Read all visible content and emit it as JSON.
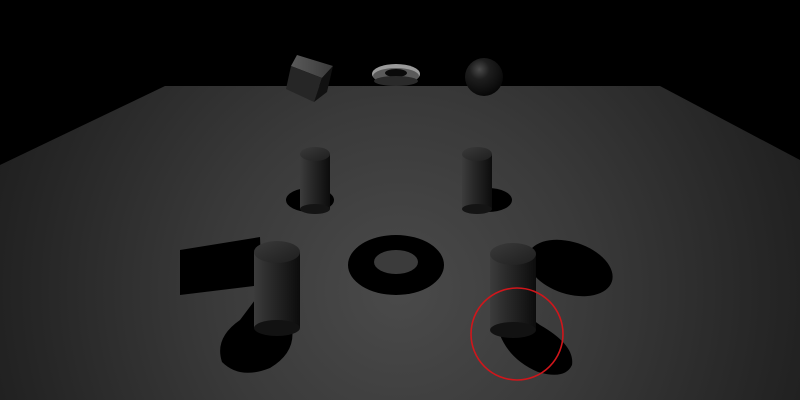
{
  "scene": {
    "background_color": "#000000",
    "highlight_ring_color": "#d0161b",
    "floating_objects": [
      "tilted-cube",
      "torus",
      "sphere"
    ],
    "floor_objects": [
      "cylinder",
      "cylinder",
      "cylinder",
      "cylinder",
      "torus-shadow"
    ],
    "shadows": [
      "cube-shadow",
      "torus-shadow",
      "sphere-shadow",
      "cylinder-shadow",
      "cylinder-shadow",
      "cylinder-shadow",
      "cylinder-shadow"
    ]
  }
}
